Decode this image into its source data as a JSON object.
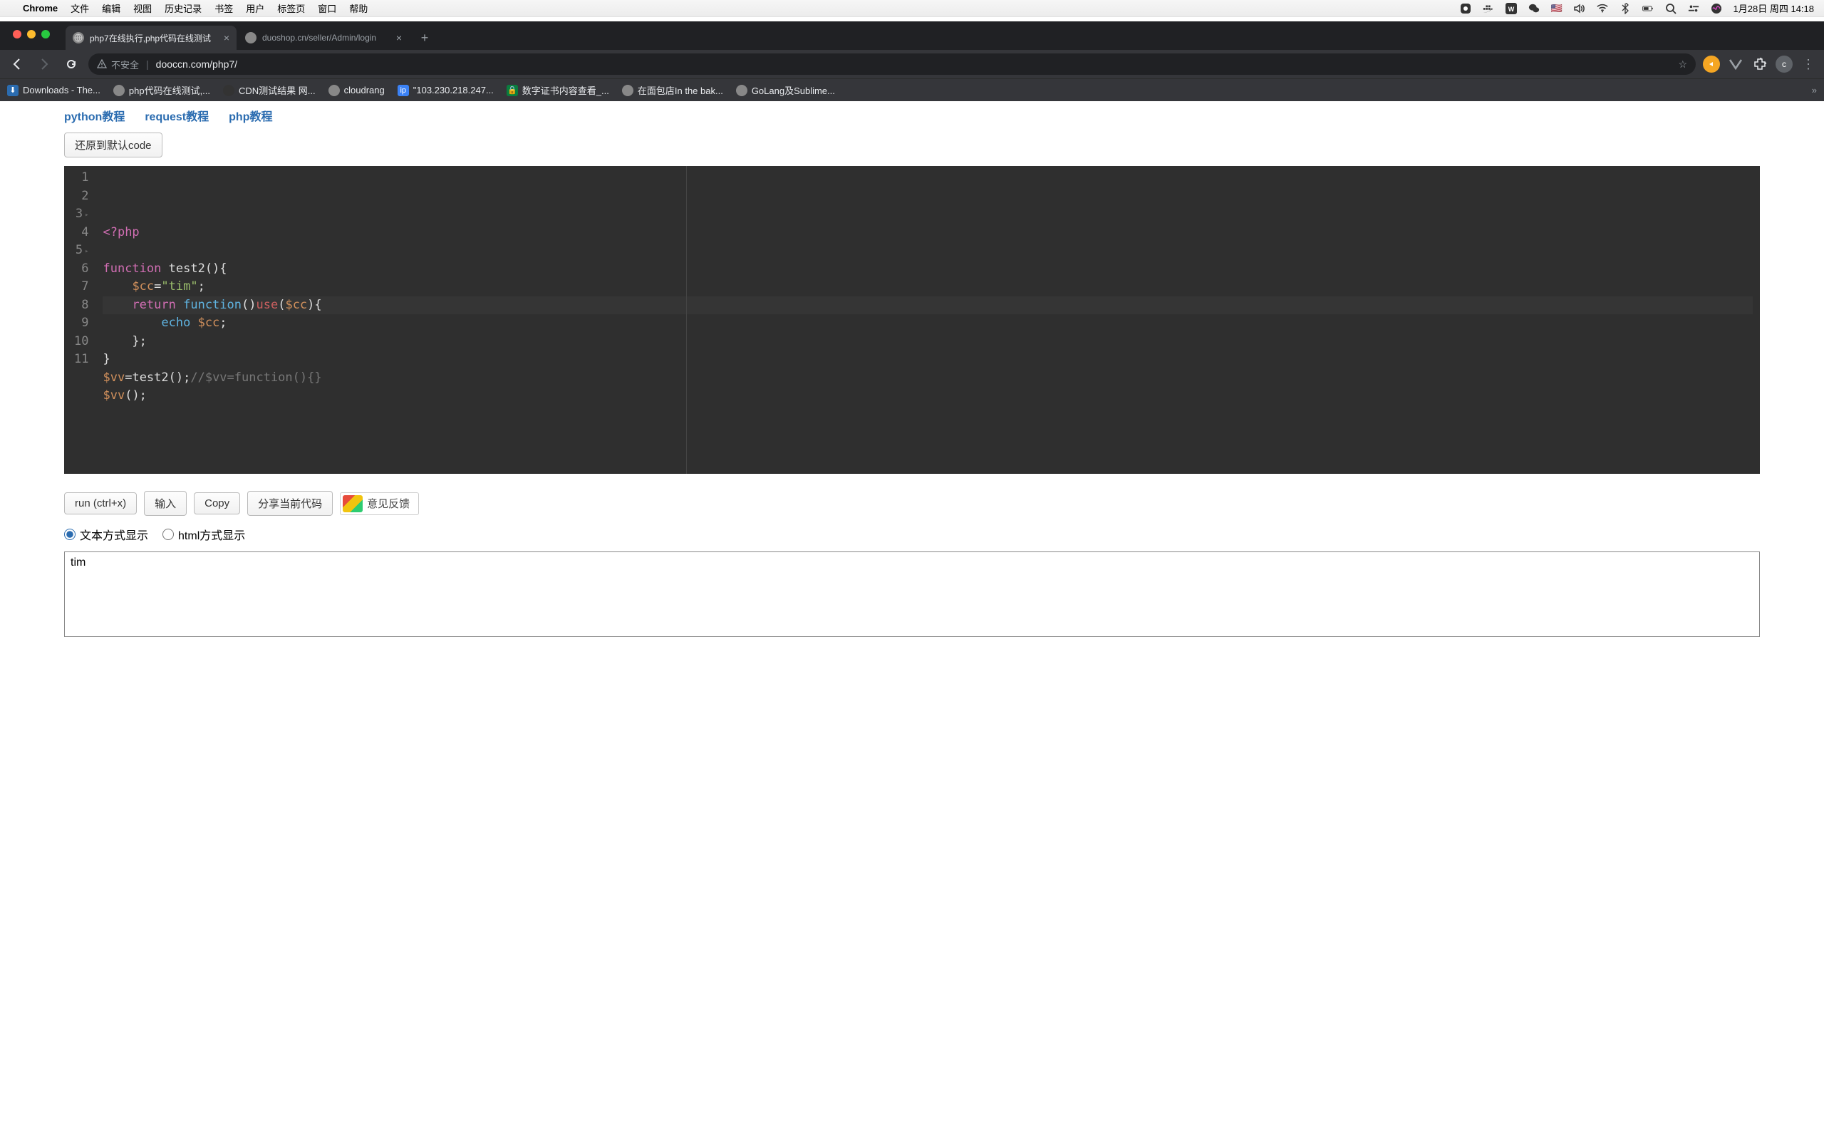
{
  "menubar": {
    "app": "Chrome",
    "items": [
      "文件",
      "编辑",
      "视图",
      "历史记录",
      "书签",
      "用户",
      "标签页",
      "窗口",
      "帮助"
    ],
    "datetime": "1月28日 周四 14:18"
  },
  "tabs": [
    {
      "title": "php7在线执行,php代码在线测试",
      "active": true
    },
    {
      "title": "duoshop.cn/seller/Admin/login",
      "active": false
    }
  ],
  "omnibox": {
    "insecure_label": "不安全",
    "url": "dooccn.com/php7/"
  },
  "bookmarks": [
    {
      "label": "Downloads - The...",
      "icon_bg": "#2b6cb0"
    },
    {
      "label": "php代码在线测试,...",
      "icon_bg": "#888"
    },
    {
      "label": "CDN测试结果 网...",
      "icon_bg": "#333"
    },
    {
      "label": "cloudrang",
      "icon_bg": "#888"
    },
    {
      "label": "\"103.230.218.247...",
      "icon_bg": "#3b82f6"
    },
    {
      "label": "数字证书内容查看_...",
      "icon_bg": "#0a7d3e"
    },
    {
      "label": "在面包店In the bak...",
      "icon_bg": "#888"
    },
    {
      "label": "GoLang及Sublime...",
      "icon_bg": "#888"
    }
  ],
  "tutorial_links": [
    "python教程",
    "request教程",
    "php教程"
  ],
  "reset_button": "还原到默认code",
  "code": {
    "lines": [
      {
        "n": 1,
        "tokens": [
          [
            "<?php",
            "kw2"
          ]
        ]
      },
      {
        "n": 2,
        "tokens": []
      },
      {
        "n": 3,
        "fold": true,
        "tokens": [
          [
            "function",
            "kw"
          ],
          [
            " ",
            "punc"
          ],
          [
            "test2",
            "name"
          ],
          [
            "(){",
            "punc"
          ]
        ]
      },
      {
        "n": 4,
        "tokens": [
          [
            "    ",
            "punc"
          ],
          [
            "$cc",
            "var"
          ],
          [
            "=",
            "punc"
          ],
          [
            "\"tim\"",
            "str"
          ],
          [
            ";",
            "punc"
          ]
        ]
      },
      {
        "n": 5,
        "fold": true,
        "highlight": true,
        "tokens": [
          [
            "    ",
            "punc"
          ],
          [
            "return",
            "ret"
          ],
          [
            " ",
            "punc"
          ],
          [
            "function",
            "fn"
          ],
          [
            "()",
            "punc"
          ],
          [
            "use",
            "use"
          ],
          [
            "(",
            "punc"
          ],
          [
            "$cc",
            "var"
          ],
          [
            "){",
            "punc"
          ]
        ]
      },
      {
        "n": 6,
        "cursor_col": 10,
        "tokens": [
          [
            "        ",
            "punc"
          ],
          [
            "echo",
            "echo"
          ],
          [
            " ",
            "punc"
          ],
          [
            "$cc",
            "var"
          ],
          [
            ";",
            "punc"
          ]
        ]
      },
      {
        "n": 7,
        "tokens": [
          [
            "    };",
            "punc"
          ]
        ]
      },
      {
        "n": 8,
        "tokens": [
          [
            "}",
            "punc"
          ]
        ]
      },
      {
        "n": 9,
        "tokens": [
          [
            "$vv",
            "var"
          ],
          [
            "=",
            "punc"
          ],
          [
            "test2",
            "name"
          ],
          [
            "();",
            "punc"
          ],
          [
            "//$vv=function(){}",
            "cmt"
          ]
        ]
      },
      {
        "n": 10,
        "tokens": [
          [
            "$vv",
            "var"
          ],
          [
            "();",
            "punc"
          ]
        ]
      },
      {
        "n": 11,
        "tokens": []
      }
    ]
  },
  "actions": {
    "run": "run (ctrl+x)",
    "input": "输入",
    "copy": "Copy",
    "share": "分享当前代码",
    "feedback": "意见反馈"
  },
  "display_mode": {
    "text": "文本方式显示",
    "html": "html方式显示",
    "selected": "text"
  },
  "output": "tim",
  "avatar_letter": "c"
}
